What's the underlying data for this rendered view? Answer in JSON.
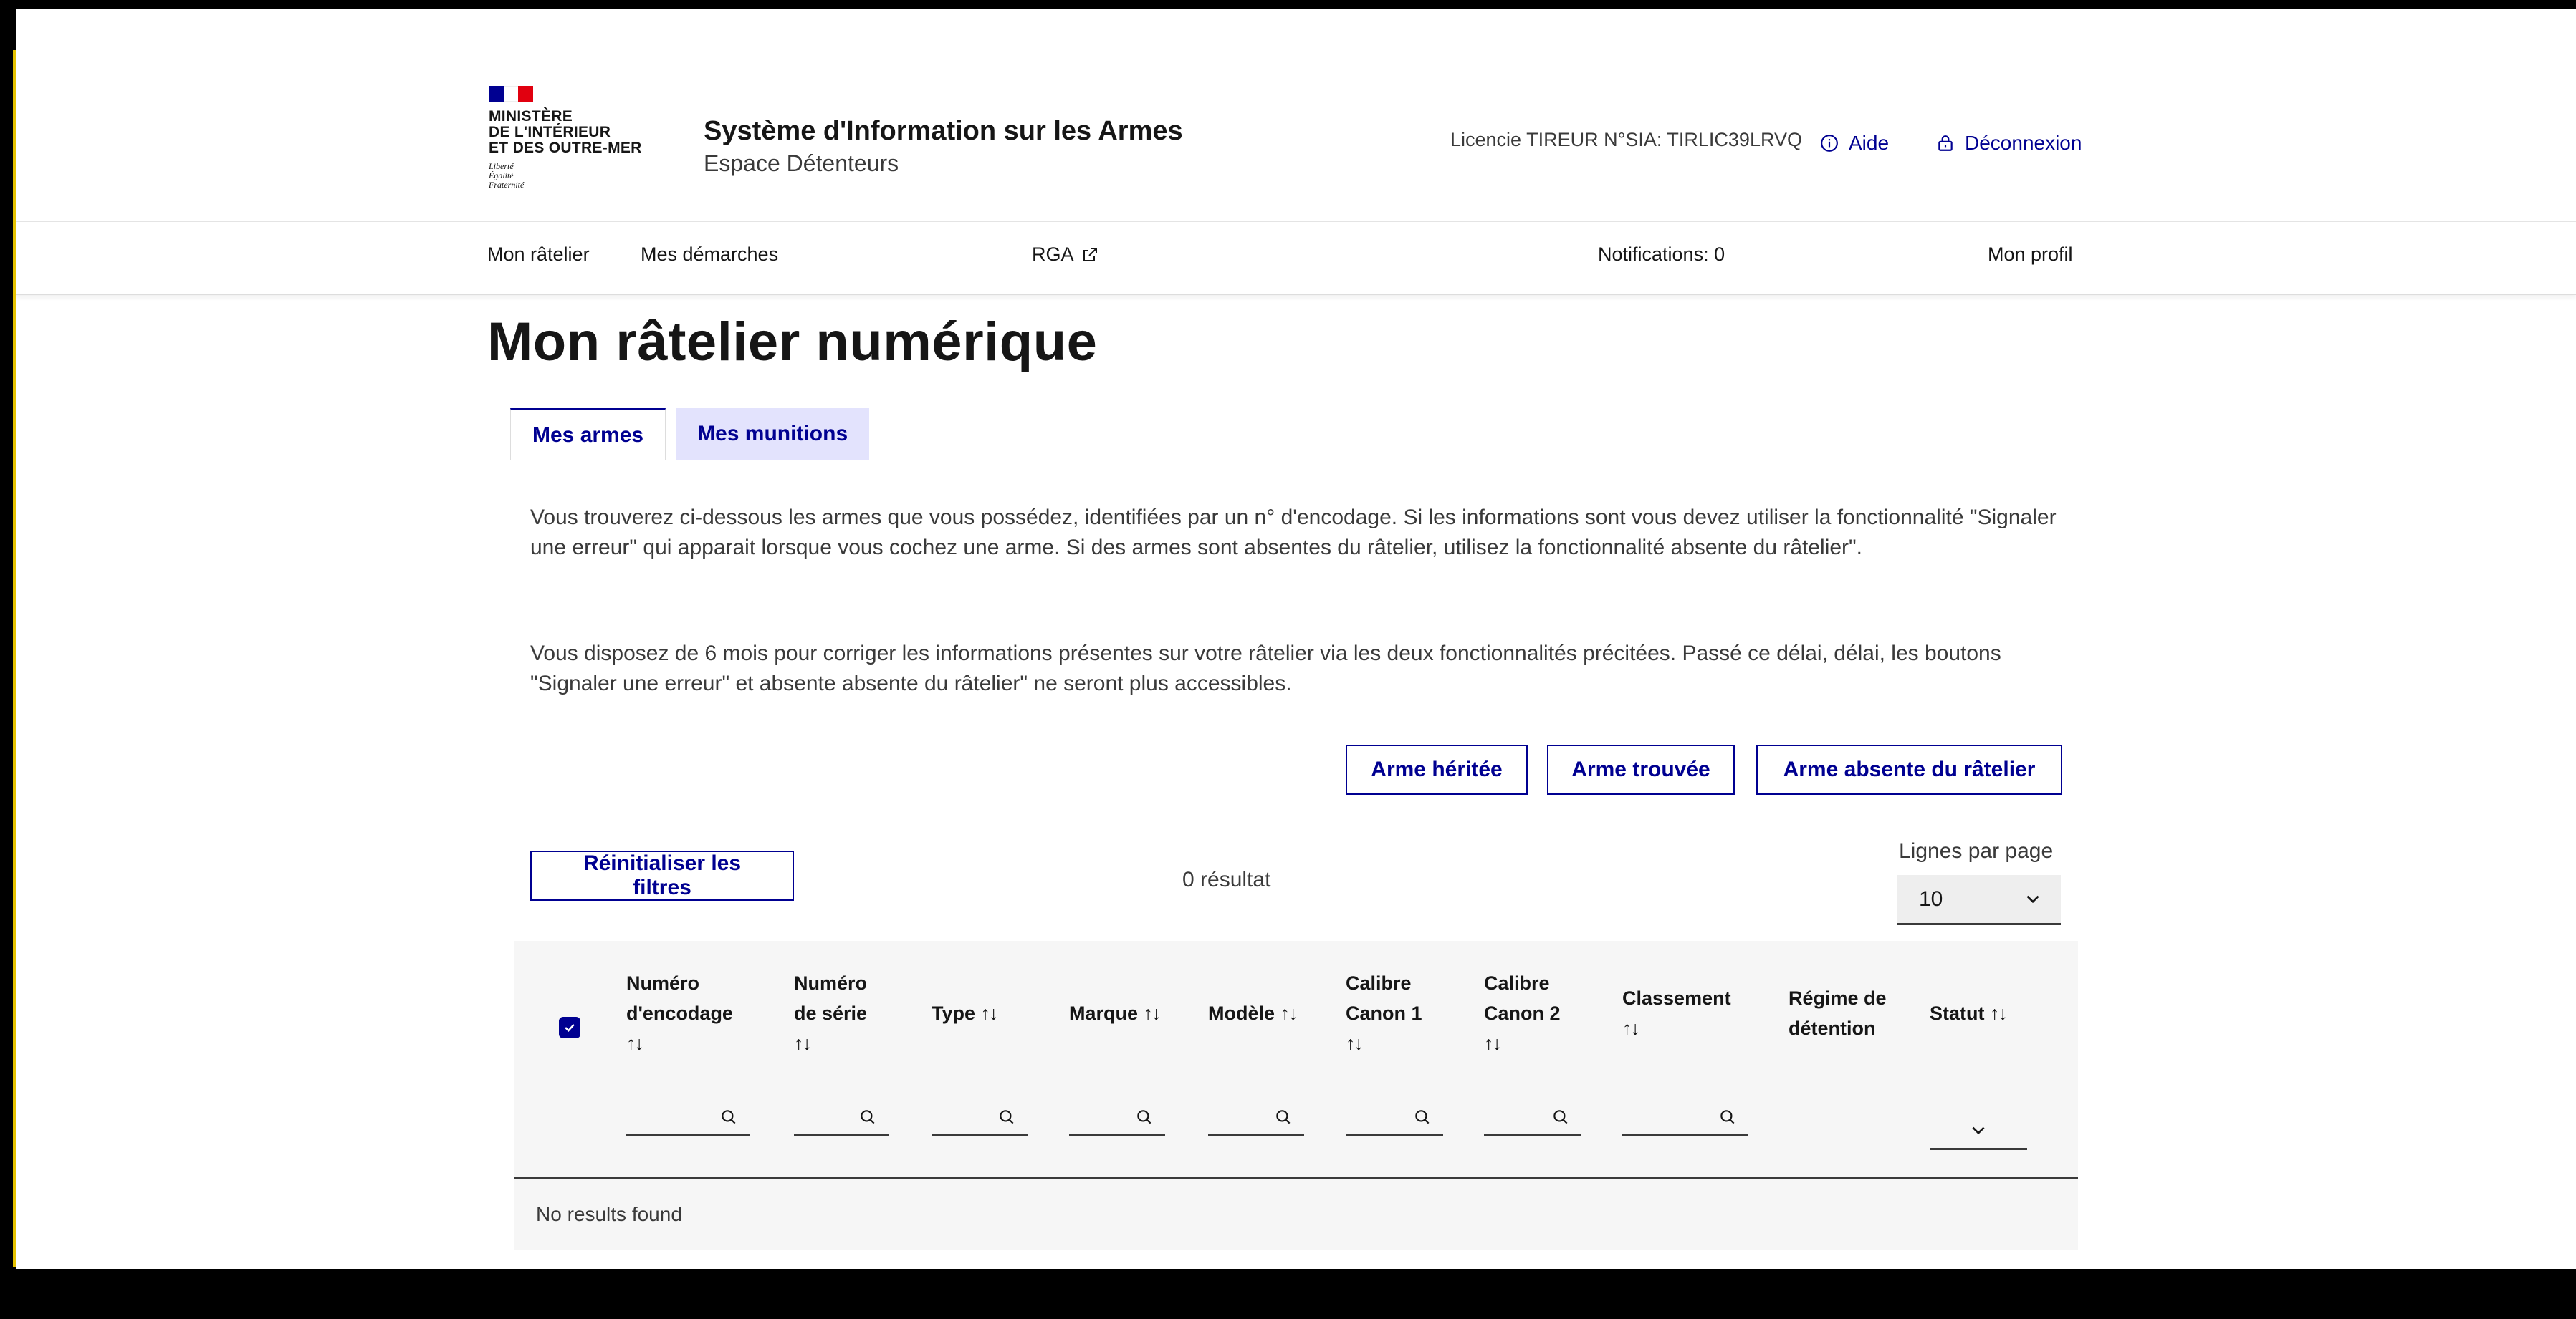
{
  "header": {
    "ministry_lines": [
      "MINISTÈRE",
      "DE L'INTÉRIEUR",
      "ET DES OUTRE-MER"
    ],
    "motto": [
      "Liberté",
      "Égalité",
      "Fraternité"
    ],
    "site_title": "Système d'Information sur les Armes",
    "site_subtitle": "Espace Détenteurs",
    "licence": "Licencie TIREUR N°SIA: TIRLIC39LRVQ",
    "aide_label": "Aide",
    "deconnexion_label": "Déconnexion"
  },
  "nav": {
    "items": [
      "Mon râtelier",
      "Mes démarches",
      "RGA"
    ],
    "notifications": "Notifications: 0",
    "profile": "Mon profil"
  },
  "main": {
    "title": "Mon râtelier numérique",
    "tabs": [
      {
        "label": "Mes armes",
        "active": true
      },
      {
        "label": "Mes munitions",
        "active": false
      }
    ],
    "paragraphs": [
      "Vous trouverez ci-dessous les armes que vous possédez, identifiées par un n° d'encodage. Si les informations sont vous devez utiliser la fonctionnalité \"Signaler une erreur\" qui apparait lorsque vous cochez une arme. Si des armes sont absentes du râtelier, utilisez la fonctionnalité absente du râtelier\".",
      "Vous disposez de 6 mois pour corriger les informations présentes sur votre râtelier via les deux fonctionnalités précitées. Passé ce délai, délai, les boutons \"Signaler une erreur\" et absente absente du râtelier\" ne seront plus accessibles."
    ],
    "actions": {
      "heritee": "Arme héritée",
      "trouvee": "Arme trouvée",
      "absente": "Arme absente du râtelier"
    },
    "reset_filters": "Réinitialiser les filtres",
    "results_count": "0 résultat",
    "lines_per_page_label": "Lignes par page",
    "lines_per_page_value": "10"
  },
  "table": {
    "columns": [
      {
        "line1": "Numéro",
        "line2": "d'encodage",
        "sort": "↑↓"
      },
      {
        "line1": "Numéro",
        "line2": "de série",
        "sort": "↑↓"
      },
      {
        "line1": "Type",
        "line2": "",
        "sort": "↑↓"
      },
      {
        "line1": "Marque",
        "line2": "",
        "sort": "↑↓"
      },
      {
        "line1": "Modèle",
        "line2": "",
        "sort": "↑↓"
      },
      {
        "line1": "Calibre",
        "line2": "Canon 1",
        "sort": "↑↓"
      },
      {
        "line1": "Calibre",
        "line2": "Canon 2",
        "sort": "↑↓"
      },
      {
        "line1": "Classement",
        "line2": "",
        "sort": "↑↓"
      },
      {
        "line1": "Régime de",
        "line2": "détention",
        "sort": ""
      },
      {
        "line1": "Statut",
        "line2": "",
        "sort": "↑↓"
      }
    ],
    "empty_message": "No results found"
  },
  "colors": {
    "primary": "#000091",
    "flag_blue": "#000091",
    "flag_white": "#ffffff",
    "flag_red": "#e1000f",
    "tab_inactive_bg": "#e3e3fd",
    "table_bg": "#f6f6f6"
  }
}
